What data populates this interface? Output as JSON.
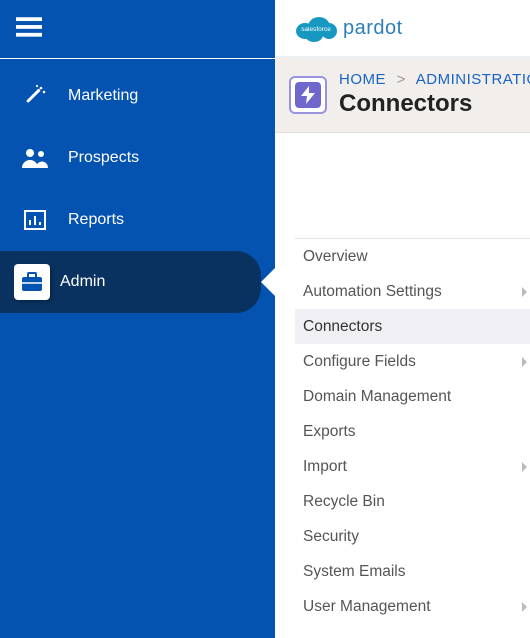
{
  "brand": {
    "cloud_text": "salesforce",
    "product": "pardot"
  },
  "sidebar": {
    "items": [
      {
        "label": "Marketing"
      },
      {
        "label": "Prospects"
      },
      {
        "label": "Reports"
      },
      {
        "label": "Admin"
      }
    ]
  },
  "header": {
    "crumb_home": "HOME",
    "crumb_section": "ADMINISTRATIO",
    "title": "Connectors"
  },
  "submenu": {
    "items": [
      {
        "label": "Overview",
        "has_children": false,
        "selected": false
      },
      {
        "label": "Automation Settings",
        "has_children": true,
        "selected": false
      },
      {
        "label": "Connectors",
        "has_children": false,
        "selected": true
      },
      {
        "label": "Configure Fields",
        "has_children": true,
        "selected": false
      },
      {
        "label": "Domain Management",
        "has_children": false,
        "selected": false
      },
      {
        "label": "Exports",
        "has_children": false,
        "selected": false
      },
      {
        "label": "Import",
        "has_children": true,
        "selected": false
      },
      {
        "label": "Recycle Bin",
        "has_children": false,
        "selected": false
      },
      {
        "label": "Security",
        "has_children": false,
        "selected": false
      },
      {
        "label": "System Emails",
        "has_children": false,
        "selected": false
      },
      {
        "label": "User Management",
        "has_children": true,
        "selected": false
      }
    ]
  }
}
